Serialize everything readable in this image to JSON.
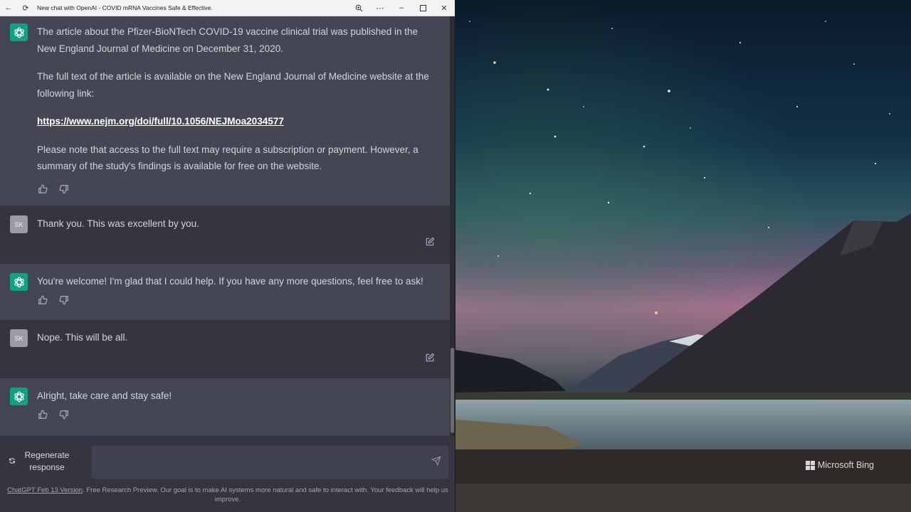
{
  "window": {
    "title": "New chat with OpenAI - COVID mRNA Vaccines Safe & Effective."
  },
  "messages": [
    {
      "role": "assistant",
      "paragraphs": [
        "The article about the Pfizer-BioNTech COVID-19 vaccine clinical trial was published in the New England Journal of Medicine on December 31, 2020.",
        "The full text of the article is available on the New England Journal of Medicine website at the following link:",
        "Please note that access to the full text may require a subscription or payment. However, a summary of the study's findings is available for free on the website."
      ],
      "link": "https://www.nejm.org/doi/full/10.1056/NEJMoa2034577"
    },
    {
      "role": "user",
      "avatar": "SK",
      "text": "Thank you. This was excellent by you."
    },
    {
      "role": "assistant",
      "text": "You're welcome! I'm glad that I could help. If you have any more questions, feel free to ask!"
    },
    {
      "role": "user",
      "avatar": "SK",
      "text": "Nope. This will be all."
    },
    {
      "role": "assistant",
      "text": "Alright, take care and stay safe!"
    }
  ],
  "composer": {
    "regenerate_label": "Regenerate response",
    "input_value": "",
    "footer_link": "ChatGPT Feb 13 Version",
    "footer_text": ". Free Research Preview. Our goal is to make AI systems more natural and safe to interact with. Your feedback will help us improve."
  },
  "desktop": {
    "watermark": "Microsoft Bing"
  },
  "colors": {
    "assistant_bg": "#444654",
    "user_bg": "#343541",
    "accent": "#10a37f"
  }
}
